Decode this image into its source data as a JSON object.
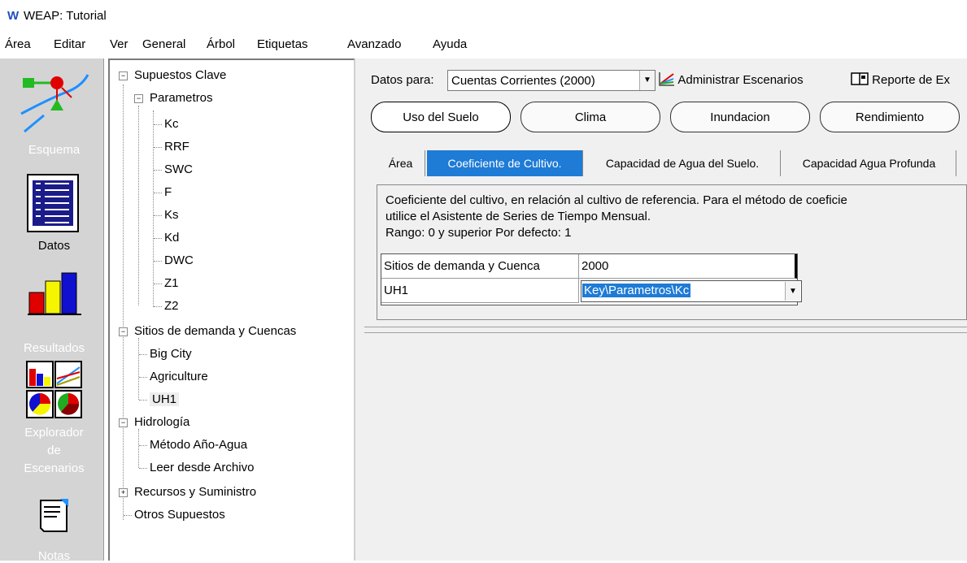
{
  "window": {
    "logo": "W",
    "title": "WEAP: Tutorial"
  },
  "menu": [
    "Área",
    "Editar",
    "Ver",
    "General",
    "Árbol",
    "Etiquetas",
    "Avanzado",
    "Ayuda"
  ],
  "leftbar": {
    "esquema": "Esquema",
    "datos": "Datos",
    "resultados": "Resultados",
    "explorador_1": "Explorador",
    "explorador_2": "de",
    "explorador_3": "Escenarios",
    "notas": "Notas"
  },
  "tree": {
    "supuestos": "Supuestos Clave",
    "parametros": "Parametros",
    "params": [
      "Kc",
      "RRF",
      "SWC",
      "F",
      "Ks",
      "Kd",
      "DWC",
      "Z1",
      "Z2"
    ],
    "sitios": "Sitios de demanda y Cuencas",
    "sitios_items": [
      "Big City",
      "Agriculture",
      "UH1"
    ],
    "hidrologia": "Hidrología",
    "hidro_items": [
      "Método Año-Agua",
      "Leer desde Archivo"
    ],
    "recursos": "Recursos y Suministro",
    "otros": "Otros Supuestos"
  },
  "toolbar": {
    "datos_para": "Datos para:",
    "scenario": "Cuentas Corrientes (2000)",
    "admin": "Administrar Escenarios",
    "reporte": "Reporte de Ex"
  },
  "categories": [
    "Uso del Suelo",
    "Clima",
    "Inundacion",
    "Rendimiento"
  ],
  "tabs": [
    "Área",
    "Coeficiente de Cultivo.",
    "Capacidad de Agua del Suelo.",
    "Capacidad Agua Profunda"
  ],
  "description": {
    "line1": "Coeficiente del cultivo, en relación al cultivo de referencia. Para el método de coeficie",
    "line2": "utilice el Asistente de Series de Tiempo Mensual.",
    "line3": "Rango: 0 y superior  Por defecto: 1"
  },
  "grid": {
    "header_col1": "Sitios de demanda y Cuenca",
    "header_col2": "2000",
    "row_name": "UH1",
    "row_value": "Key\\Parametros\\Kc"
  }
}
